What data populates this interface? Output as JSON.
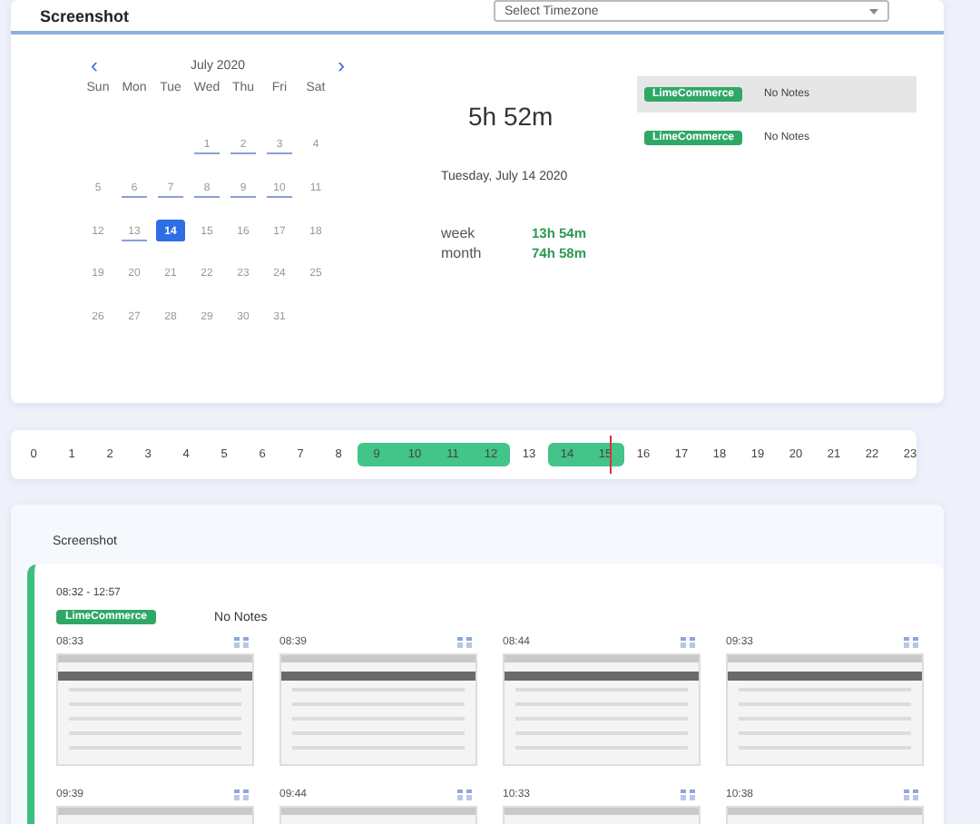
{
  "header": {
    "title": "Screenshot",
    "timezone_placeholder": "Select Timezone"
  },
  "calendar": {
    "month": "July 2020",
    "prev": "‹",
    "next": "›",
    "weekdays": [
      "Sun",
      "Mon",
      "Tue",
      "Wed",
      "Thu",
      "Fri",
      "Sat"
    ],
    "weeks": [
      [
        {
          "day": "1",
          "active": true,
          "selected": false
        },
        {
          "day": "2",
          "active": true,
          "selected": false
        },
        {
          "day": "3",
          "active": true,
          "selected": false
        },
        {
          "day": "4",
          "active": false,
          "selected": false
        }
      ],
      [
        {
          "day": "5",
          "active": false,
          "selected": false
        },
        {
          "day": "6",
          "active": true,
          "selected": false
        },
        {
          "day": "7",
          "active": true,
          "selected": false
        },
        {
          "day": "8",
          "active": true,
          "selected": false
        },
        {
          "day": "9",
          "active": true,
          "selected": false
        },
        {
          "day": "10",
          "active": true,
          "selected": false
        },
        {
          "day": "11",
          "active": false,
          "selected": false
        }
      ],
      [
        {
          "day": "12",
          "active": false,
          "selected": false
        },
        {
          "day": "13",
          "active": true,
          "selected": false
        },
        {
          "day": "14",
          "active": true,
          "selected": true
        },
        {
          "day": "15",
          "active": false,
          "selected": false
        },
        {
          "day": "16",
          "active": false,
          "selected": false
        },
        {
          "day": "17",
          "active": false,
          "selected": false
        },
        {
          "day": "18",
          "active": false,
          "selected": false
        }
      ],
      [
        {
          "day": "19",
          "active": false,
          "selected": false
        },
        {
          "day": "20",
          "active": false,
          "selected": false
        },
        {
          "day": "21",
          "active": false,
          "selected": false
        },
        {
          "day": "22",
          "active": false,
          "selected": false
        },
        {
          "day": "23",
          "active": false,
          "selected": false
        },
        {
          "day": "24",
          "active": false,
          "selected": false
        },
        {
          "day": "25",
          "active": false,
          "selected": false
        }
      ],
      [
        {
          "day": "26",
          "active": false,
          "selected": false
        },
        {
          "day": "27",
          "active": false,
          "selected": false
        },
        {
          "day": "28",
          "active": false,
          "selected": false
        },
        {
          "day": "29",
          "active": false,
          "selected": false
        },
        {
          "day": "30",
          "active": false,
          "selected": false
        },
        {
          "day": "31",
          "active": false,
          "selected": false
        }
      ]
    ]
  },
  "summary": {
    "total": "5h 52m",
    "date": "Tuesday, July 14 2020",
    "stats": [
      {
        "label": "week",
        "value": "13h 54m"
      },
      {
        "label": "month",
        "value": "74h 58m"
      }
    ]
  },
  "projects": [
    {
      "tag": "LimeCommerce",
      "notes": "No Notes",
      "selected": true
    },
    {
      "tag": "LimeCommerce",
      "notes": "No Notes",
      "selected": false
    }
  ],
  "timeline": [
    {
      "hour": "0",
      "active": false,
      "current": false
    },
    {
      "hour": "1",
      "active": false,
      "current": false
    },
    {
      "hour": "2",
      "active": false,
      "current": false
    },
    {
      "hour": "3",
      "active": false,
      "current": false
    },
    {
      "hour": "4",
      "active": false,
      "current": false
    },
    {
      "hour": "5",
      "active": false,
      "current": false
    },
    {
      "hour": "6",
      "active": false,
      "current": false
    },
    {
      "hour": "7",
      "active": false,
      "current": false
    },
    {
      "hour": "8",
      "active": false,
      "current": false
    },
    {
      "hour": "9",
      "active": true,
      "current": false
    },
    {
      "hour": "10",
      "active": true,
      "current": false
    },
    {
      "hour": "11",
      "active": true,
      "current": false
    },
    {
      "hour": "12",
      "active": true,
      "current": false
    },
    {
      "hour": "13",
      "active": false,
      "current": false
    },
    {
      "hour": "14",
      "active": true,
      "current": false
    },
    {
      "hour": "15",
      "active": true,
      "current": true
    },
    {
      "hour": "16",
      "active": false,
      "current": false
    },
    {
      "hour": "17",
      "active": false,
      "current": false
    },
    {
      "hour": "18",
      "active": false,
      "current": false
    },
    {
      "hour": "19",
      "active": false,
      "current": false
    },
    {
      "hour": "20",
      "active": false,
      "current": false
    },
    {
      "hour": "21",
      "active": false,
      "current": false
    },
    {
      "hour": "22",
      "active": false,
      "current": false
    },
    {
      "hour": "23",
      "active": false,
      "current": false
    }
  ],
  "screenshots": {
    "title": "Screenshot",
    "session": {
      "range": "08:32 - 12:57",
      "tag": "LimeCommerce",
      "notes": "No Notes"
    },
    "items": [
      {
        "time": "08:33"
      },
      {
        "time": "08:39"
      },
      {
        "time": "08:44"
      },
      {
        "time": "09:33"
      },
      {
        "time": "09:39"
      },
      {
        "time": "09:44"
      },
      {
        "time": "10:33"
      },
      {
        "time": "10:38"
      }
    ]
  }
}
